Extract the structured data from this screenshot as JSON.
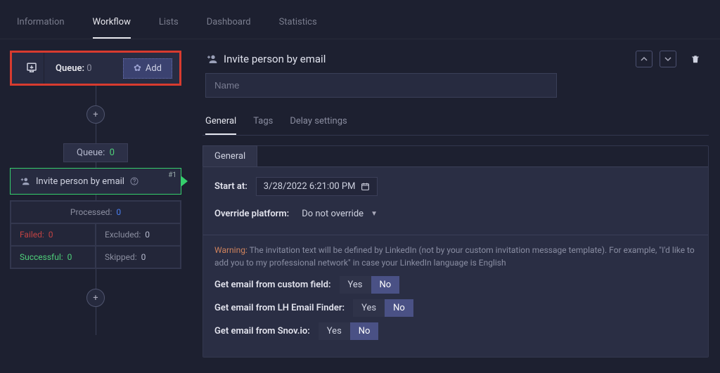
{
  "tabs": {
    "information": "Information",
    "workflow": "Workflow",
    "lists": "Lists",
    "dashboard": "Dashboard",
    "statistics": "Statistics"
  },
  "queue": {
    "label": "Queue",
    "count": "0",
    "add": "Add"
  },
  "flow": {
    "queue_badge_label": "Queue:",
    "queue_badge_count": "0",
    "step_title": "Invite person by email",
    "step_index": "#1",
    "processed_label": "Processed:",
    "processed_value": "0",
    "failed_label": "Failed:",
    "failed_value": "0",
    "excluded_label": "Excluded:",
    "excluded_value": "0",
    "successful_label": "Successful:",
    "successful_value": "0",
    "skipped_label": "Skipped:",
    "skipped_value": "0"
  },
  "panel": {
    "title": "Invite person by email",
    "name_placeholder": "Name",
    "subtabs": {
      "general": "General",
      "tags": "Tags",
      "delay": "Delay settings"
    },
    "inner_tab": "General",
    "start_at_label": "Start at:",
    "start_at_value": "3/28/2022 6:21:00 PM",
    "override_label": "Override platform:",
    "override_value": "Do not override",
    "warning_prefix": "Warning:",
    "warning_text": "The invitation text will be defined by LinkedIn (not by your custom invitation message template). For example, \"I'd like to add you to my professional network\" in case your LinkedIn language is English",
    "opt1": "Get email from custom field:",
    "opt2": "Get email from LH Email Finder:",
    "opt3": "Get email from Snov.io:",
    "yes": "Yes",
    "no": "No"
  }
}
